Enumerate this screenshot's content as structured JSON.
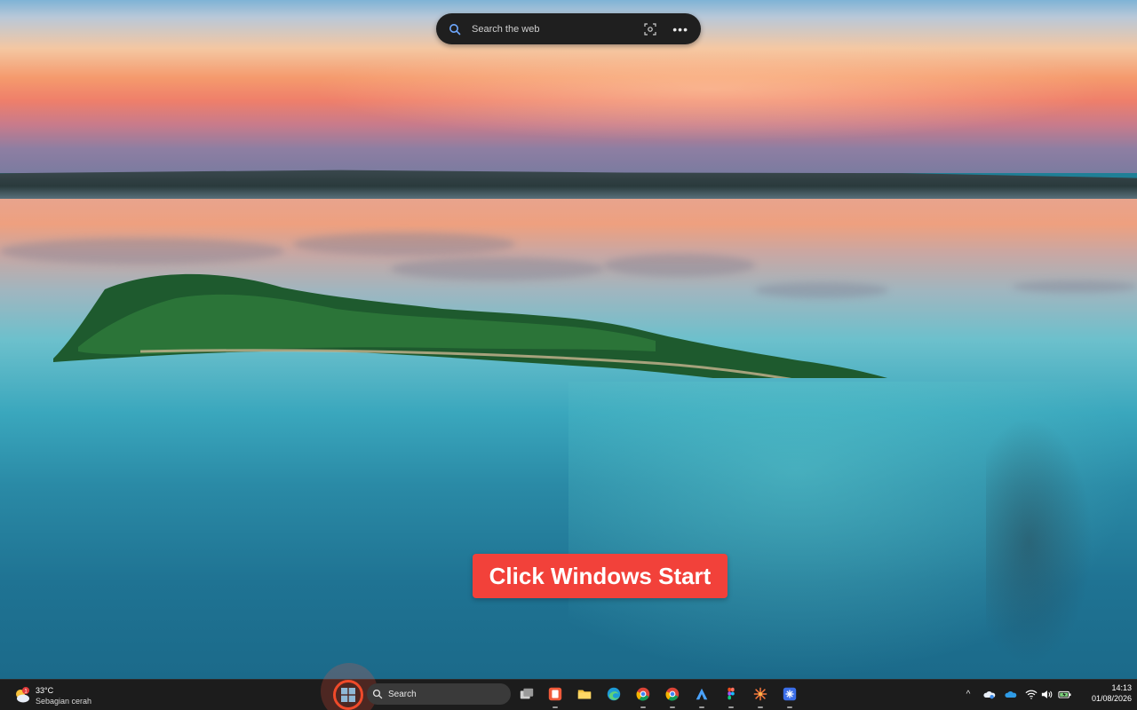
{
  "web_search": {
    "placeholder": "Search the web",
    "icons": [
      "search-icon",
      "visual-search-icon",
      "more-icon"
    ]
  },
  "callout": {
    "text": "Click Windows Start",
    "color": "#f2413a"
  },
  "taskbar": {
    "weather": {
      "temperature": "33°C",
      "condition": "Sebagian cerah",
      "badge": "1"
    },
    "search_label": "Search",
    "apps": [
      {
        "name": "task-view-icon"
      },
      {
        "name": "app-red-icon"
      },
      {
        "name": "file-explorer-icon"
      },
      {
        "name": "edge-icon"
      },
      {
        "name": "chrome-icon"
      },
      {
        "name": "chrome-profile-icon"
      },
      {
        "name": "app-a-icon"
      },
      {
        "name": "figma-icon"
      },
      {
        "name": "app-star-icon"
      },
      {
        "name": "app-blue-icon"
      }
    ],
    "tray": {
      "show_hidden": "^",
      "clock_time": "14:13",
      "clock_date": "01/08/2026"
    }
  },
  "colors": {
    "accent_ring": "#f04a2a",
    "taskbar_bg": "#1c1c1c"
  }
}
